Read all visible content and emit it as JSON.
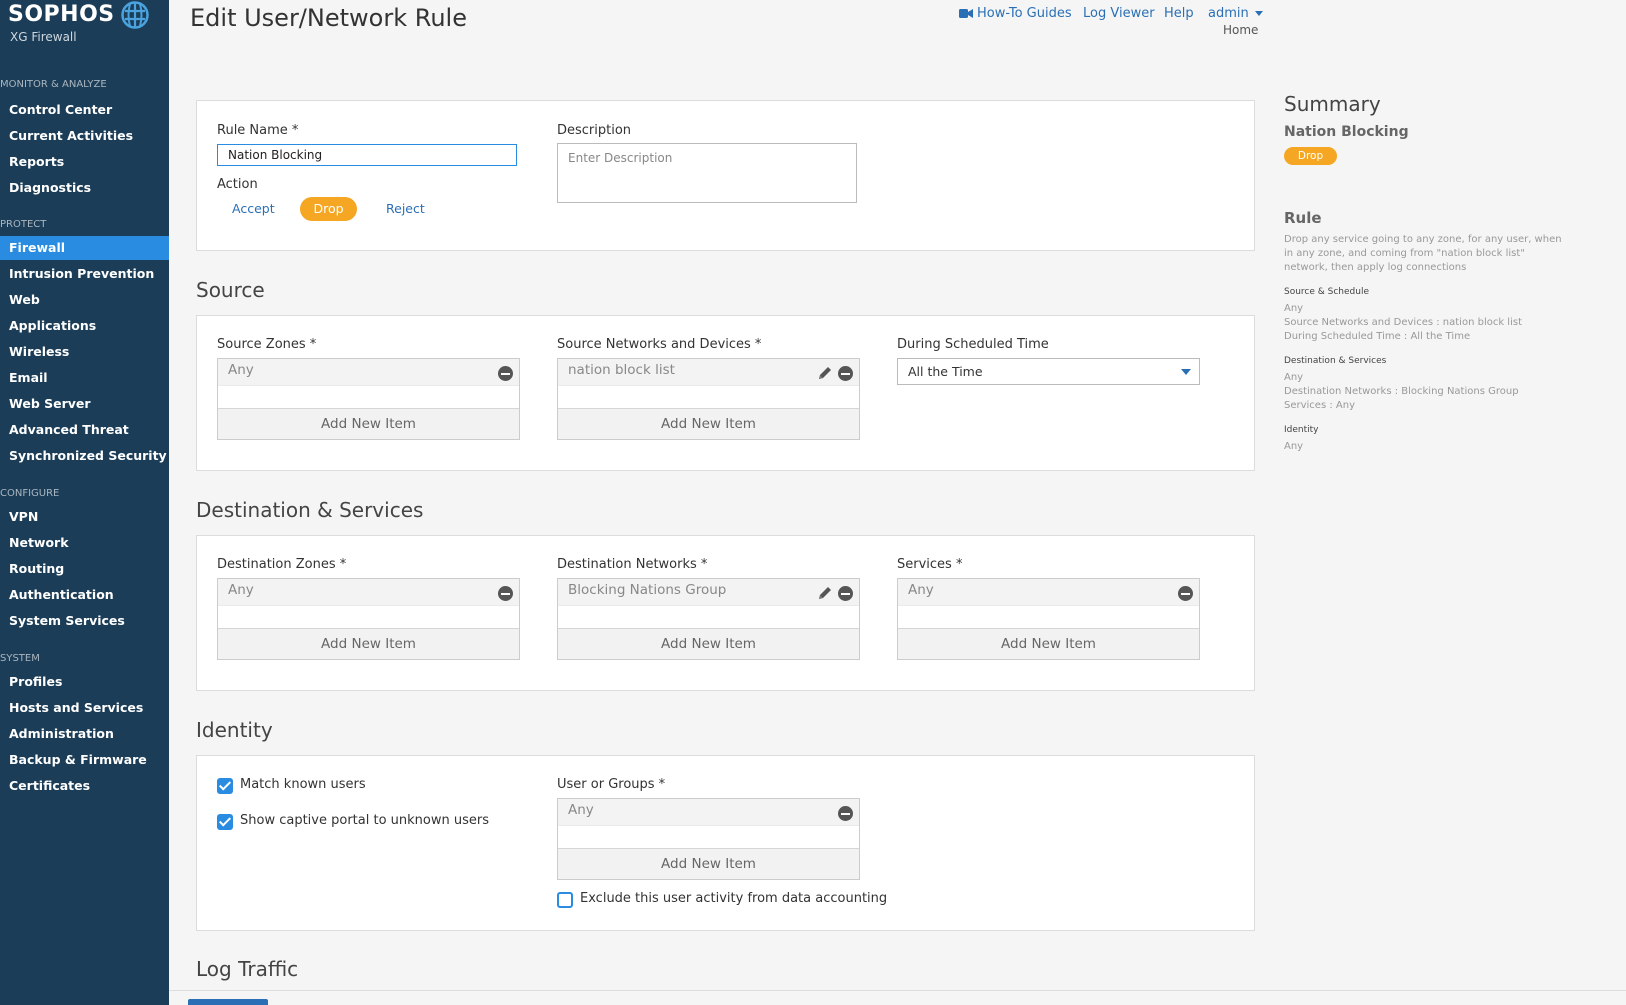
{
  "brand": {
    "name": "SOPHOS",
    "product": "XG Firewall"
  },
  "sidebar": {
    "sections": [
      {
        "title": "MONITOR & ANALYZE",
        "items": [
          {
            "label": "Control Center",
            "active": false
          },
          {
            "label": "Current Activities",
            "active": false
          },
          {
            "label": "Reports",
            "active": false
          },
          {
            "label": "Diagnostics",
            "active": false
          }
        ]
      },
      {
        "title": "PROTECT",
        "items": [
          {
            "label": "Firewall",
            "active": true
          },
          {
            "label": "Intrusion Prevention",
            "active": false
          },
          {
            "label": "Web",
            "active": false
          },
          {
            "label": "Applications",
            "active": false
          },
          {
            "label": "Wireless",
            "active": false
          },
          {
            "label": "Email",
            "active": false
          },
          {
            "label": "Web Server",
            "active": false
          },
          {
            "label": "Advanced Threat",
            "active": false
          },
          {
            "label": "Synchronized Security",
            "active": false
          }
        ]
      },
      {
        "title": "CONFIGURE",
        "items": [
          {
            "label": "VPN",
            "active": false
          },
          {
            "label": "Network",
            "active": false
          },
          {
            "label": "Routing",
            "active": false
          },
          {
            "label": "Authentication",
            "active": false
          },
          {
            "label": "System Services",
            "active": false
          }
        ]
      },
      {
        "title": "SYSTEM",
        "items": [
          {
            "label": "Profiles",
            "active": false
          },
          {
            "label": "Hosts and Services",
            "active": false
          },
          {
            "label": "Administration",
            "active": false
          },
          {
            "label": "Backup & Firmware",
            "active": false
          },
          {
            "label": "Certificates",
            "active": false
          }
        ]
      }
    ]
  },
  "header": {
    "title": "Edit User/Network Rule",
    "links": {
      "howto": "How-To Guides",
      "log_viewer": "Log Viewer",
      "help": "Help",
      "user": "admin"
    },
    "breadcrumb": "Home"
  },
  "rule": {
    "name_label": "Rule Name *",
    "name_value": "Nation Blocking",
    "description_label": "Description",
    "description_placeholder": "Enter Description",
    "action_label": "Action",
    "actions": {
      "accept": "Accept",
      "drop": "Drop",
      "reject": "Reject"
    },
    "selected_action": "Drop"
  },
  "source": {
    "heading": "Source",
    "zones_label": "Source Zones *",
    "zones_value": "Any",
    "networks_label": "Source Networks and Devices *",
    "networks_value": "nation block list",
    "schedule_label": "During Scheduled Time",
    "schedule_value": "All the Time"
  },
  "destination": {
    "heading": "Destination & Services",
    "zones_label": "Destination Zones *",
    "zones_value": "Any",
    "networks_label": "Destination Networks *",
    "networks_value": "Blocking Nations Group",
    "services_label": "Services *",
    "services_value": "Any"
  },
  "identity": {
    "heading": "Identity",
    "match_known_users": "Match known users",
    "match_known_checked": true,
    "captive_portal": "Show captive portal to unknown users",
    "captive_checked": true,
    "users_label": "User or Groups *",
    "users_value": "Any",
    "exclude_label": "Exclude this user activity from data accounting",
    "exclude_checked": false
  },
  "add_new_item": "Add New Item",
  "log_traffic_heading": "Log Traffic",
  "summary": {
    "title": "Summary",
    "rule_name": "Nation Blocking",
    "action_badge": "Drop",
    "rule_title": "Rule",
    "rule_desc": "Drop any service going to any zone, for any user, when in any zone, and coming from \"nation block list\" network, then apply log connections",
    "source_head": "Source & Schedule",
    "source_lines": [
      "Any",
      "Source Networks and Devices : nation block list",
      "During Scheduled Time : All the Time"
    ],
    "dest_head": "Destination & Services",
    "dest_lines": [
      "Any",
      "Destination Networks : Blocking Nations Group",
      "Services : Any"
    ],
    "identity_head": "Identity",
    "identity_lines": [
      "Any"
    ]
  },
  "colors": {
    "sidebar_bg": "#1b3d57",
    "accent_blue": "#2a8ce0",
    "drop_orange": "#f5a623",
    "link_blue": "#2a6fb5"
  },
  "icons": {
    "logo": "globe-icon",
    "howto": "video-camera-icon",
    "remove": "minus-circle-icon",
    "edit": "pencil-icon",
    "dropdown": "caret-down-icon",
    "check": "checkbox-icon"
  }
}
